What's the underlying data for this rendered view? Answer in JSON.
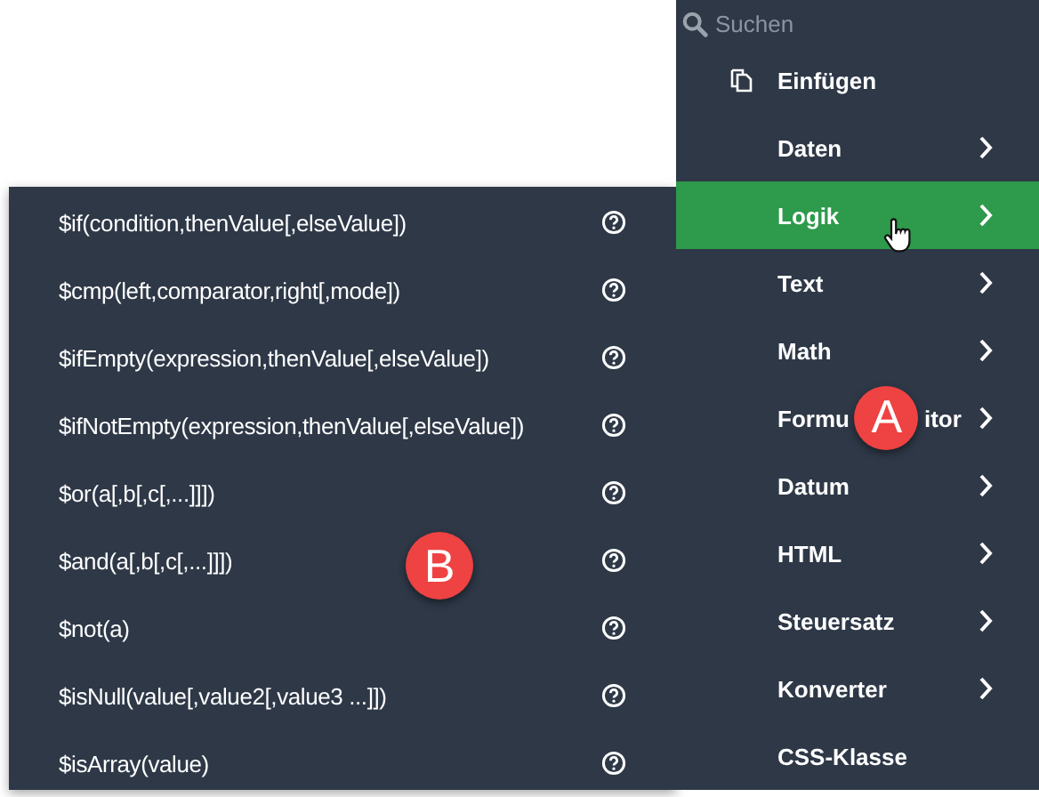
{
  "menu": {
    "search": {
      "placeholder": "Suchen"
    },
    "items": [
      {
        "label": "Einfügen",
        "kind": "icon-command",
        "selected": false
      },
      {
        "label": "Daten",
        "kind": "submenu",
        "selected": false
      },
      {
        "label": "Logik",
        "kind": "submenu",
        "selected": true
      },
      {
        "label": "Text",
        "kind": "submenu",
        "selected": false
      },
      {
        "label": "Math",
        "kind": "submenu",
        "selected": false
      },
      {
        "label": "Formu",
        "label_tail": "itor",
        "badge": "A",
        "kind": "submenu",
        "selected": false
      },
      {
        "label": "Datum",
        "kind": "submenu",
        "selected": false
      },
      {
        "label": "HTML",
        "kind": "submenu",
        "selected": false
      },
      {
        "label": "Steuersatz",
        "kind": "submenu",
        "selected": false
      },
      {
        "label": "Konverter",
        "kind": "submenu",
        "selected": false
      },
      {
        "label": "CSS-Klasse",
        "kind": "command",
        "selected": false
      }
    ]
  },
  "submenu": {
    "badge": "B",
    "items": [
      {
        "label": "$if(condition,thenValue[,elseValue])"
      },
      {
        "label": "$cmp(left,comparator,right[,mode])"
      },
      {
        "label": "$ifEmpty(expression,thenValue[,elseValue])"
      },
      {
        "label": "$ifNotEmpty(expression,thenValue[,elseValue])"
      },
      {
        "label": "$or(a[,b[,c[,...]]])"
      },
      {
        "label": "$and(a[,b[,c[,...]]])"
      },
      {
        "label": "$not(a)"
      },
      {
        "label": "$isNull(value[,value2[,value3 ...]])"
      },
      {
        "label": "$isArray(value)"
      }
    ]
  }
}
